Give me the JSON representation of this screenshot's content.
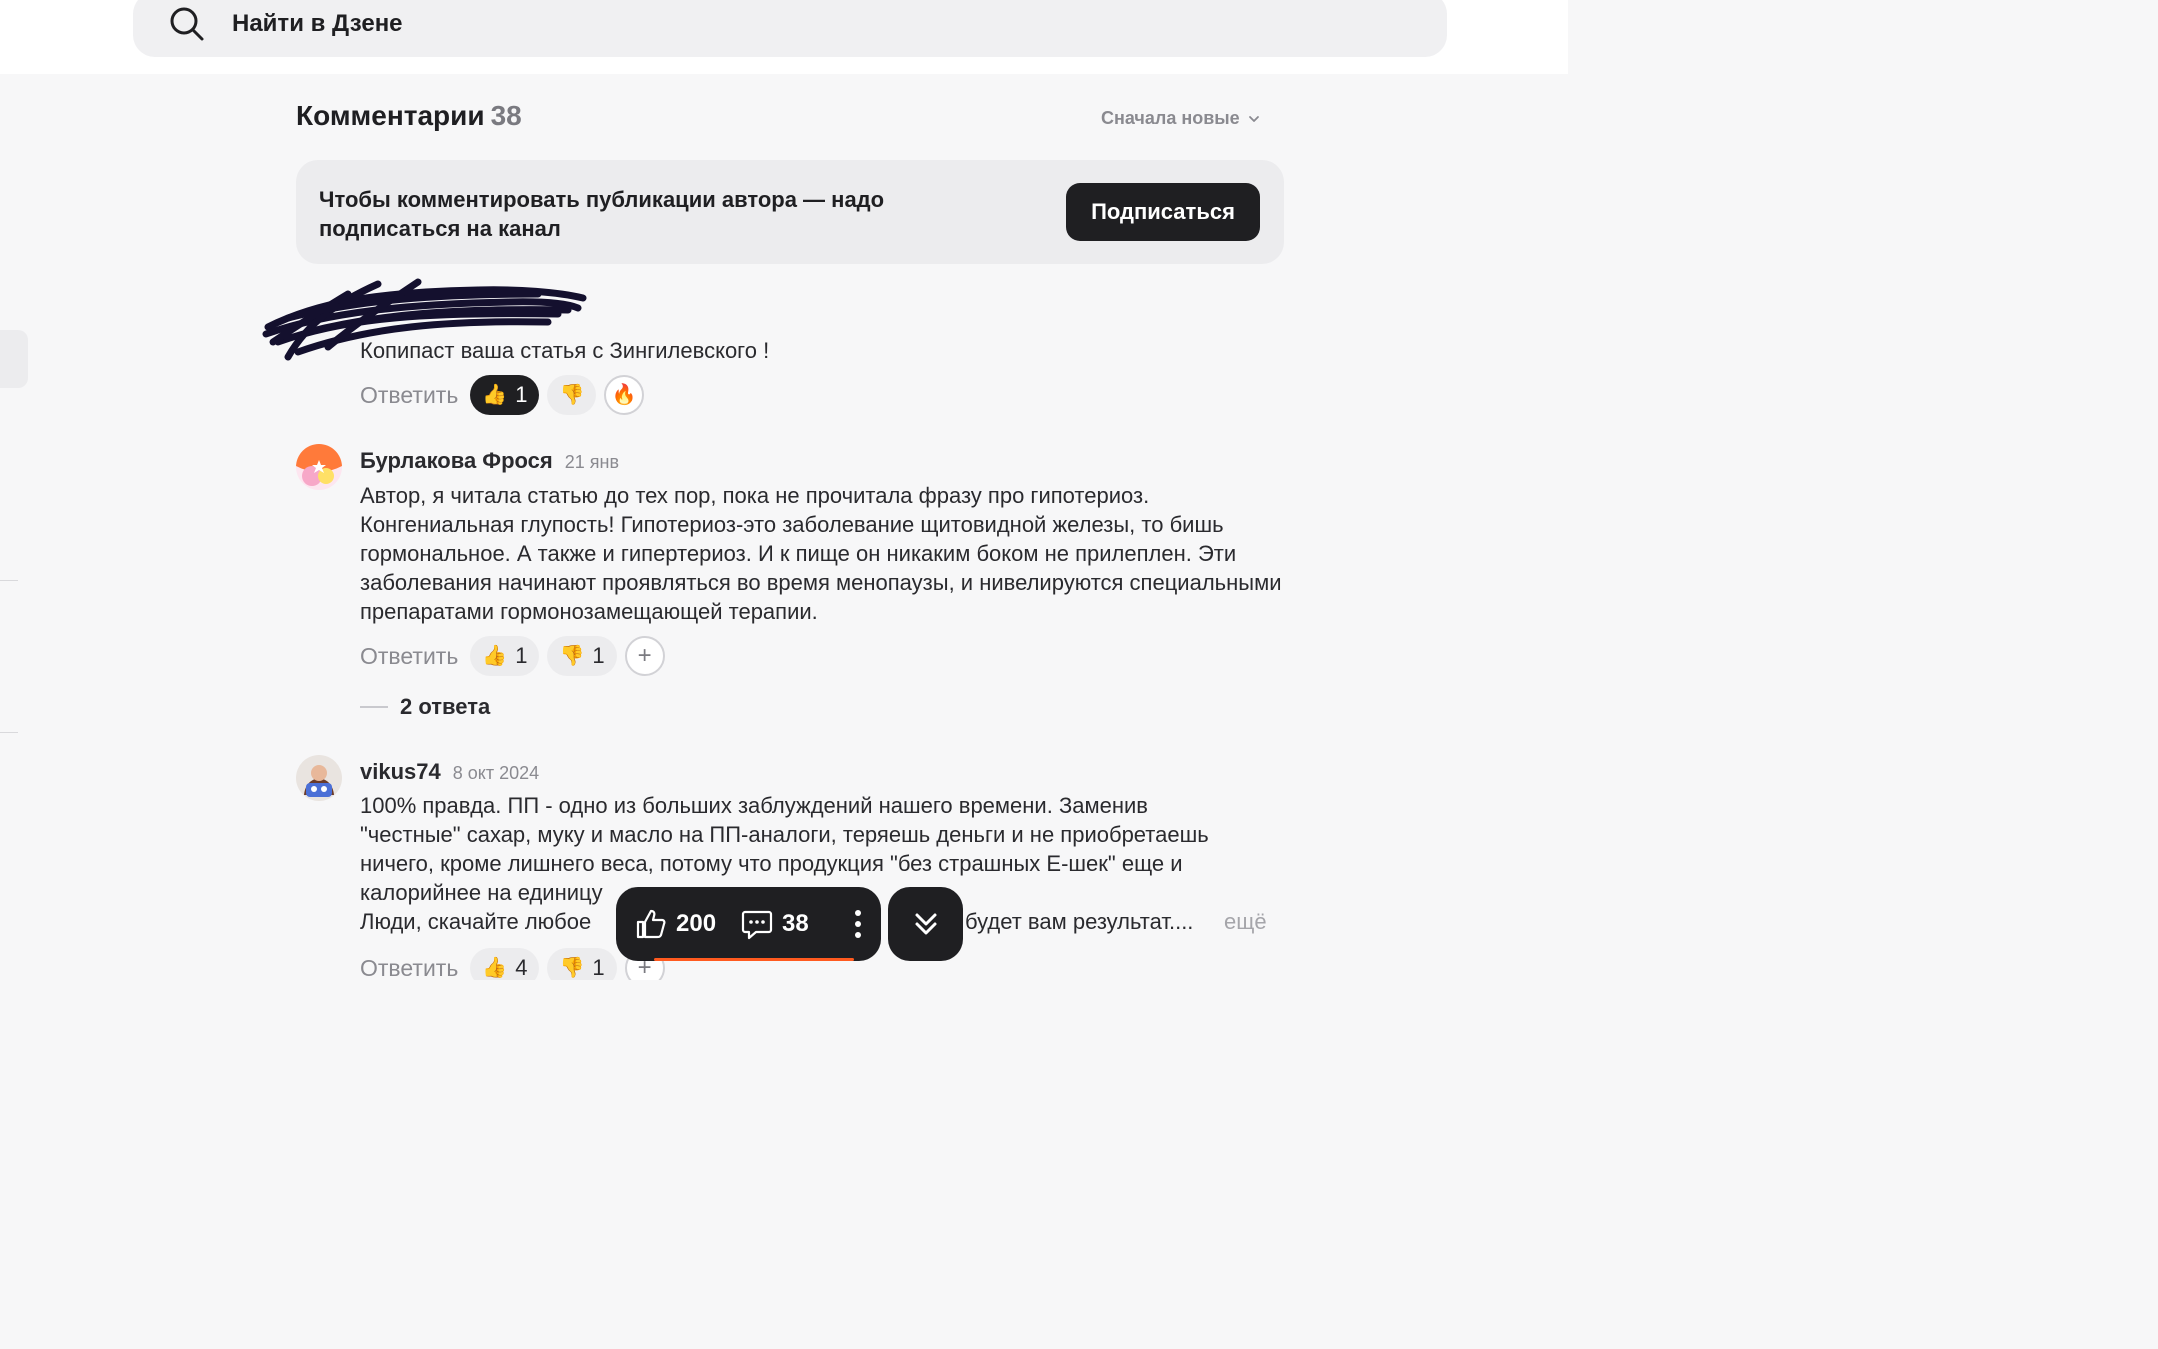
{
  "search": {
    "placeholder": "Найти в Дзене"
  },
  "comments": {
    "title": "Комментарии",
    "count": "38",
    "sort_label": "Сначала новые"
  },
  "subscribe": {
    "text": "Чтобы комментировать публикации автора — надо подписаться на канал",
    "button_label": "Подписаться"
  },
  "reply_label": "Ответить",
  "comment_list": [
    {
      "author": "",
      "date": "",
      "text": "Копипаст ваша статья с Зингилевского !",
      "likes": "1",
      "like_active": true,
      "dislikes": "",
      "extra_reaction": "fire-icon"
    },
    {
      "author": "Бурлакова Фрося",
      "date": "21 янв",
      "text": "Автор, я читала статью до тех пор, пока не прочитала фразу про гипотериоз. Конгениальная глупость! Гипотериоз-это заболевание щитовидной железы, то бишь гормональное. А также и гипертериоз. И к пище он никаким боком не прилеплен. Эти заболевания начинают проявляться во время менопаузы, и нивелируются специальными препаратами гормонозамещающей терапии.",
      "likes": "1",
      "dislikes": "1",
      "replies_label": "2 ответа"
    },
    {
      "author": "vikus74",
      "date": "8 окт 2024",
      "text_lines": [
        "100% правда. ПП - одно из больших заблуждений нашего времени. Заменив",
        "\"честные\" сахар, муку и масло на ПП-аналоги, теряешь деньги и не приобретаешь",
        "ничего, кроме лишнего веса, потому что продукция \"без страшных Е-шек\" еще и",
        "калорийнее на единицу",
        "Люди, скачайте любое",
        "будет вам результат...."
      ],
      "more_label": "ещё",
      "likes": "4",
      "dislikes": "1"
    }
  ],
  "floatbar": {
    "likes": "200",
    "comments": "38"
  },
  "colors": {
    "dark": "#1f1f22",
    "accent_orange": "#ff5a1f",
    "muted": "#8a8a90",
    "surface": "#ececee"
  }
}
